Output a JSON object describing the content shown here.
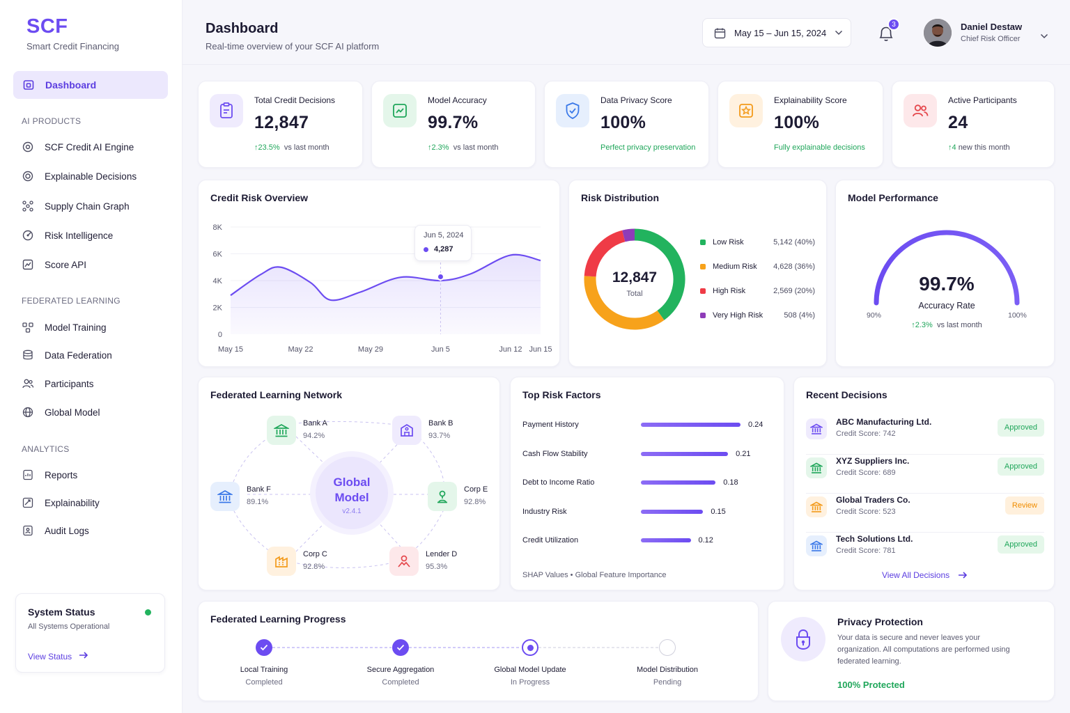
{
  "brand": {
    "name": "SCF",
    "subtitle": "Smart Credit Financing"
  },
  "sidebar": {
    "active": {
      "label": "Dashboard",
      "icon": "home-icon"
    },
    "sections": [
      {
        "title": "AI PRODUCTS",
        "items": [
          {
            "label": "SCF Credit AI Engine",
            "icon": "gear-icon"
          },
          {
            "label": "Explainable Decisions",
            "icon": "target-icon"
          },
          {
            "label": "Supply Chain Graph",
            "icon": "network-icon"
          },
          {
            "label": "Risk Intelligence",
            "icon": "radar-icon"
          },
          {
            "label": "Score API",
            "icon": "chart-icon"
          }
        ]
      },
      {
        "title": "FEDERATED LEARNING",
        "items": [
          {
            "label": "Model Training",
            "icon": "training-icon"
          },
          {
            "label": "Data Federation",
            "icon": "database-icon"
          },
          {
            "label": "Participants",
            "icon": "users-icon"
          },
          {
            "label": "Global Model",
            "icon": "globe-icon"
          }
        ]
      },
      {
        "title": "ANALYTICS",
        "items": [
          {
            "label": "Reports",
            "icon": "report-icon"
          },
          {
            "label": "Explainability",
            "icon": "explain-icon"
          },
          {
            "label": "Audit Logs",
            "icon": "audit-icon"
          }
        ]
      }
    ],
    "status": {
      "title": "System Status",
      "text": "All Systems Operational",
      "link": "View Status",
      "color": "#22b35e"
    }
  },
  "header": {
    "title": "Dashboard",
    "subtitle": "Real-time overview of your SCF AI platform",
    "date_range": "May 15 – Jun 15, 2024",
    "notifications": "3",
    "user": {
      "name": "Daniel Destaw",
      "role": "Chief Risk Officer"
    }
  },
  "kpis": [
    {
      "label": "Total Credit Decisions",
      "value": "12,847",
      "delta": "↑23.5%",
      "foot": "vs last month",
      "icon": "clipboard-icon",
      "bg": "#efebfd",
      "fg": "#6c4cf1"
    },
    {
      "label": "Model Accuracy",
      "value": "99.7%",
      "delta": "↑2.3%",
      "foot": "vs last month",
      "icon": "trend-icon",
      "bg": "#e4f6ea",
      "fg": "#1fa65a"
    },
    {
      "label": "Data Privacy Score",
      "value": "100%",
      "delta": "",
      "foot": "Perfect privacy preservation",
      "icon": "shield-icon",
      "bg": "#e6effd",
      "fg": "#3a78e8"
    },
    {
      "label": "Explainability Score",
      "value": "100%",
      "delta": "",
      "foot": "Fully explainable decisions",
      "icon": "star-icon",
      "bg": "#fff1df",
      "fg": "#f39a1a"
    },
    {
      "label": "Active Participants",
      "value": "24",
      "delta": "↑4",
      "foot": "new this month",
      "icon": "people-icon",
      "bg": "#fde8ea",
      "fg": "#e5484d"
    }
  ],
  "credit_risk": {
    "title": "Credit Risk Overview",
    "tooltip": {
      "date": "Jun 5, 2024",
      "value": "4,287"
    },
    "chart_data": {
      "type": "area",
      "title": "Credit Risk Overview",
      "x_ticks": [
        "May 15",
        "May 22",
        "May 29",
        "Jun 5",
        "Jun 12",
        "Jun 15"
      ],
      "y_ticks": [
        "8K",
        "6K",
        "4K",
        "2K",
        "0"
      ],
      "ylim": [
        0,
        8000
      ],
      "points": [
        {
          "x": "May 15",
          "y": 2900
        },
        {
          "x": "May 18",
          "y": 4450
        },
        {
          "x": "May 20",
          "y": 5000
        },
        {
          "x": "May 23",
          "y": 3850
        },
        {
          "x": "May 25",
          "y": 2550
        },
        {
          "x": "May 28",
          "y": 3150
        },
        {
          "x": "Jun 1",
          "y": 4250
        },
        {
          "x": "Jun 5",
          "y": 4000
        },
        {
          "x": "Jun 8",
          "y": 4500
        },
        {
          "x": "Jun 12",
          "y": 5900
        },
        {
          "x": "Jun 15",
          "y": 5500
        }
      ],
      "highlight": {
        "x": "Jun 5",
        "y": 4287
      },
      "color": "#6c4cf1"
    }
  },
  "risk_distribution": {
    "title": "Risk Distribution",
    "center_value": "12,847",
    "center_label": "Total",
    "chart_data": {
      "type": "pie",
      "slices": [
        {
          "label": "Low Risk",
          "value": 5142,
          "display": "5,142 (40%)",
          "color": "#22b35e"
        },
        {
          "label": "Medium Risk",
          "value": 4628,
          "display": "4,628 (36%)",
          "color": "#f7a21b"
        },
        {
          "label": "High Risk",
          "value": 2569,
          "display": "2,569 (20%)",
          "color": "#ef3b46"
        },
        {
          "label": "Very High Risk",
          "value": 508,
          "display": "508 (4%)",
          "color": "#8e3cb8"
        }
      ]
    }
  },
  "model_performance": {
    "title": "Model Performance",
    "value": "99.7%",
    "label": "Accuracy Rate",
    "min": "90%",
    "max": "100%",
    "delta": "↑2.3%",
    "foot": "vs last month",
    "level": 0.97
  },
  "fl_network": {
    "title": "Federated Learning Network",
    "center": {
      "line1": "Global",
      "line2": "Model",
      "version": "v2.4.1"
    },
    "nodes": [
      {
        "name": "Bank A",
        "score": "94.2%",
        "icon": "bank-icon",
        "bg": "#e4f6ea",
        "fg": "#1fa65a"
      },
      {
        "name": "Bank B",
        "score": "93.7%",
        "icon": "bank-icon",
        "bg": "#efebfd",
        "fg": "#6c4cf1"
      },
      {
        "name": "Bank F",
        "score": "89.1%",
        "icon": "bank-icon",
        "bg": "#e6effd",
        "fg": "#3a78e8"
      },
      {
        "name": "Corp E",
        "score": "92.8%",
        "icon": "person-icon",
        "bg": "#e4f6ea",
        "fg": "#1fa65a"
      },
      {
        "name": "Corp C",
        "score": "92.8%",
        "icon": "factory-icon",
        "bg": "#fff1df",
        "fg": "#f39a1a"
      },
      {
        "name": "Lender D",
        "score": "95.3%",
        "icon": "lender-icon",
        "bg": "#fde8ea",
        "fg": "#e5484d"
      }
    ]
  },
  "risk_factors": {
    "title": "Top Risk Factors",
    "footer": "SHAP Values • Global Feature Importance",
    "chart_data": {
      "type": "bar",
      "categories": [
        "Payment History",
        "Cash Flow Stability",
        "Debt to Income Ratio",
        "Industry Risk",
        "Credit Utilization"
      ],
      "values": [
        0.24,
        0.21,
        0.18,
        0.15,
        0.12
      ],
      "labels": [
        "0.24",
        "0.21",
        "0.18",
        "0.15",
        "0.12"
      ],
      "xlim": [
        0,
        0.24
      ]
    }
  },
  "recent_decisions": {
    "title": "Recent Decisions",
    "link": "View All Decisions",
    "rows": [
      {
        "name": "ABC Manufacturing Ltd.",
        "score": "Credit Score: 742",
        "status": "Approved",
        "kind": "ok",
        "bg": "#efebfd",
        "fg": "#6c4cf1"
      },
      {
        "name": "XYZ Suppliers Inc.",
        "score": "Credit Score: 689",
        "status": "Approved",
        "kind": "ok",
        "bg": "#e4f6ea",
        "fg": "#1fa65a"
      },
      {
        "name": "Global Traders Co.",
        "score": "Credit Score: 523",
        "status": "Review",
        "kind": "rev",
        "bg": "#fff1df",
        "fg": "#f39a1a"
      },
      {
        "name": "Tech Solutions Ltd.",
        "score": "Credit Score: 781",
        "status": "Approved",
        "kind": "ok",
        "bg": "#e6effd",
        "fg": "#3a78e8"
      }
    ]
  },
  "fl_progress": {
    "title": "Federated Learning Progress",
    "steps": [
      {
        "name": "Local Training",
        "state": "Completed",
        "status": "done"
      },
      {
        "name": "Secure Aggregation",
        "state": "Completed",
        "status": "done"
      },
      {
        "name": "Global Model Update",
        "state": "In Progress",
        "status": "active"
      },
      {
        "name": "Model Distribution",
        "state": "Pending",
        "status": "pending"
      }
    ]
  },
  "privacy": {
    "title": "Privacy Protection",
    "text": "Your data is secure and never leaves your organization. All computations are performed using federated learning.",
    "status": "100% Protected"
  }
}
